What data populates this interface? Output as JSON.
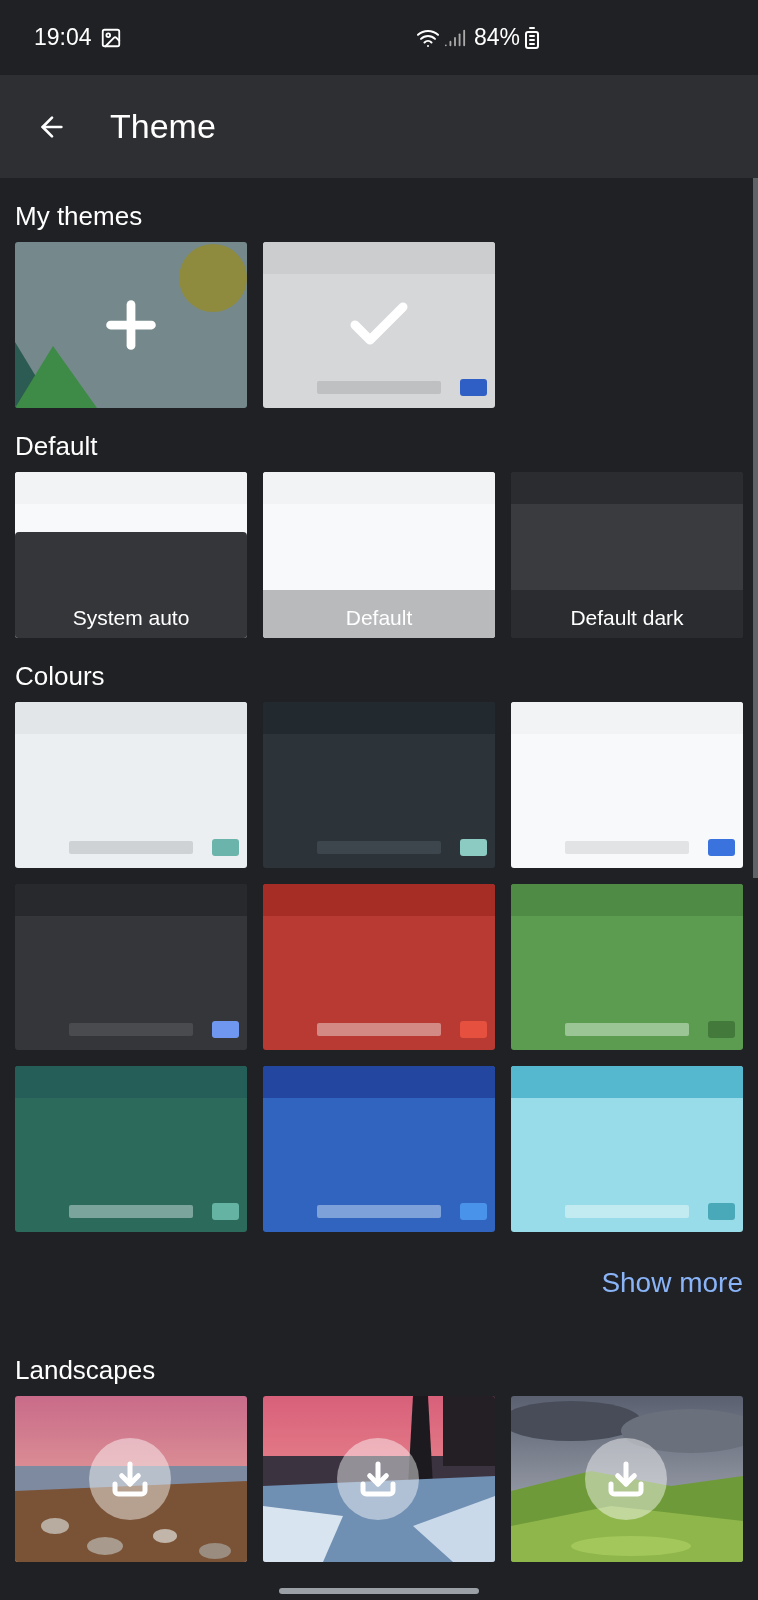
{
  "status_bar": {
    "time": "19:04",
    "battery": "84%"
  },
  "app_bar": {
    "title": "Theme"
  },
  "sections": [
    {
      "title": "My themes",
      "tiles": [
        {
          "kind": "add"
        },
        {
          "kind": "swatch",
          "selected": true
        }
      ]
    },
    {
      "title": "Default",
      "tiles": [
        {
          "kind": "split",
          "selected": false,
          "label": "System auto"
        },
        {
          "kind": "labeled",
          "selected": false,
          "label": "Default"
        },
        {
          "kind": "labeled",
          "selected": false,
          "label": "Default dark"
        }
      ]
    },
    {
      "title": "Colours",
      "tiles": [
        {
          "kind": "swatch",
          "selected": false
        },
        {
          "kind": "swatch",
          "selected": false
        },
        {
          "kind": "swatch",
          "selected": false
        },
        {
          "kind": "swatch",
          "selected": false
        },
        {
          "kind": "swatch",
          "selected": false
        },
        {
          "kind": "swatch",
          "selected": false
        },
        {
          "kind": "swatch",
          "selected": false
        },
        {
          "kind": "swatch",
          "selected": false
        },
        {
          "kind": "swatch",
          "selected": false
        }
      ]
    }
  ],
  "show_more": "Show more",
  "landscapes": {
    "title": "Landscapes"
  }
}
